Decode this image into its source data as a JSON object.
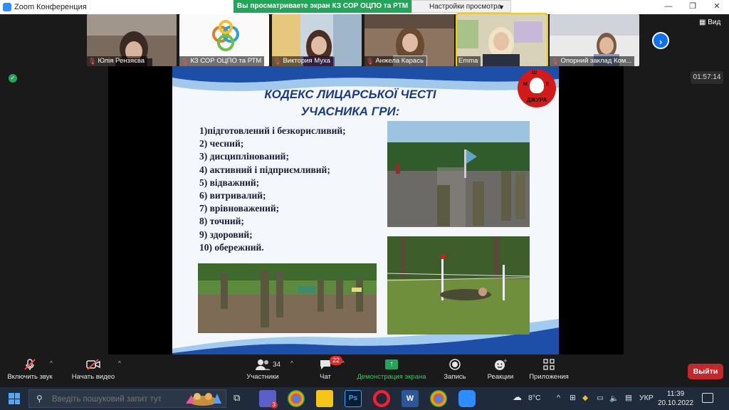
{
  "window": {
    "title": "Zoom Конференция",
    "share_banner": "Вы просматриваете экран КЗ СОР ОЦПО та РТМ",
    "view_options": "Настройки просмотра",
    "controls": [
      "—",
      "❐",
      "✕"
    ]
  },
  "participants": [
    {
      "name": "Юлія Рензяєва",
      "muted": true
    },
    {
      "name": "КЗ СОР ОЦПО та РТМ",
      "muted": true
    },
    {
      "name": "Виктория Муха",
      "muted": true
    },
    {
      "name": "Анжела Карась",
      "muted": true
    },
    {
      "name": "Emma",
      "muted": false
    },
    {
      "name": "Опорний заклад Ком...",
      "muted": true
    }
  ],
  "view_button": "Вид",
  "timer": "01:57:14",
  "slide": {
    "title_line1": "КОДЕКС ЛИЦАРСЬКОЇ ЧЕСТІ",
    "title_line2": "УЧАСНИКА ГРИ:",
    "logo_text": "ДЖУРА",
    "logo_letters": [
      "Ш",
      "М",
      "Е"
    ],
    "items": [
      "1)підготовлений і безкорисливий;",
      "2) чесний;",
      "3) дисциплінований;",
      "4) активний і підприємливий;",
      "5) відважний;",
      "6) витривалий;",
      "7) врівноважений;",
      "8) точний;",
      "9) здоровий;",
      "10) обережний."
    ]
  },
  "toolbar": {
    "audio": "Включить звук",
    "video": "Начать видео",
    "participants": "Участники",
    "participants_count": "34",
    "chat": "Чат",
    "chat_badge": "22",
    "share": "Демонстрация экрана",
    "record": "Запись",
    "reactions": "Реакции",
    "apps": "Приложения",
    "leave": "Выйти"
  },
  "taskbar": {
    "search_placeholder": "Введіть пошуковий запит тут",
    "teams_badge": "3",
    "weather": "8°C",
    "language": "УКР",
    "time": "11:39",
    "date": "20.10.2022"
  },
  "colors": {
    "accent": "#0e72ed",
    "share_green": "#23a559",
    "leave_red": "#c5282a",
    "slide_title": "#1b3a8a"
  }
}
